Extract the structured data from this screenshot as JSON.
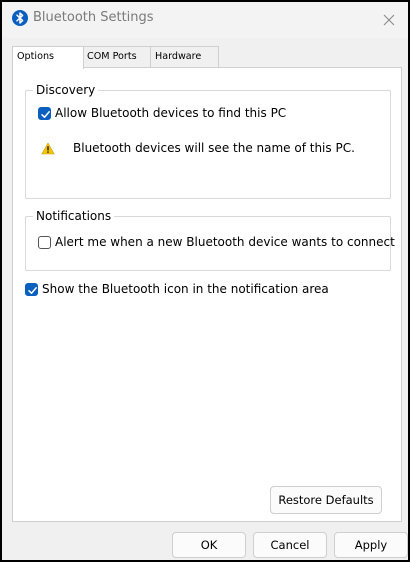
{
  "window": {
    "title": "Bluetooth Settings",
    "icons": {
      "app": "bluetooth-icon",
      "close": "close-icon"
    }
  },
  "tabs": [
    {
      "label": "Options",
      "active": true
    },
    {
      "label": "COM Ports",
      "active": false
    },
    {
      "label": "Hardware",
      "active": false
    }
  ],
  "discovery": {
    "legend": "Discovery",
    "allow_label": "Allow Bluetooth devices to find this PC",
    "allow_checked": true,
    "warning_icon": "warning-icon",
    "warning_text": "Bluetooth devices will see the name of this PC."
  },
  "notifications": {
    "legend": "Notifications",
    "alert_label": "Alert me when a new Bluetooth device wants to connect",
    "alert_checked": false
  },
  "show_icon": {
    "label": "Show the Bluetooth icon in the notification area",
    "checked": true
  },
  "buttons": {
    "restore_defaults": "Restore Defaults",
    "ok": "OK",
    "cancel": "Cancel",
    "apply": "Apply"
  },
  "colors": {
    "accent": "#0a5fbf",
    "warning": "#f5c400",
    "window_bg": "#f0f0f0",
    "panel_bg": "#ffffff"
  }
}
